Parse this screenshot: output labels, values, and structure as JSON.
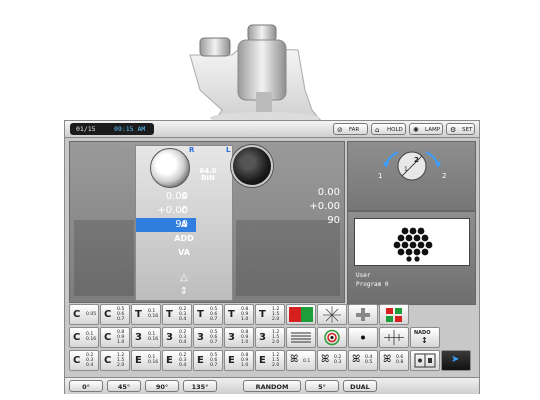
{
  "topbar": {
    "date": "01/15",
    "time": "09:15 AM",
    "buttons": [
      {
        "label": "FAR",
        "icon": "lens-icon"
      },
      {
        "label": "HOLD",
        "icon": "lock-icon"
      },
      {
        "label": "LAMP",
        "icon": "lamp-icon"
      },
      {
        "label": "SET",
        "icon": "gear-icon"
      }
    ]
  },
  "refraction": {
    "right_eye_label": "R",
    "left_eye_label": "L",
    "pd_value": "64.0",
    "pd_mode": "BIN",
    "rows": [
      {
        "label": "S",
        "right": "0.00",
        "left": "0.00"
      },
      {
        "label": "C",
        "right": "+0.00",
        "left": "+0.00"
      },
      {
        "label": "A",
        "right": "90",
        "left": "90"
      },
      {
        "label": "ADD",
        "right": "",
        "left": ""
      },
      {
        "label": "VA",
        "right": "",
        "left": ""
      }
    ]
  },
  "rotation": {
    "left_num": "1",
    "center_num": "2",
    "right_num": "2",
    "dial_num": "1"
  },
  "program": {
    "user_label": "User",
    "program_label": "Program 0"
  },
  "chart_grid": [
    [
      {
        "big": "C",
        "small": [
          "0.05"
        ]
      },
      {
        "big": "C",
        "small": [
          "0.5",
          "0.6",
          "0.7"
        ]
      },
      {
        "big": "T",
        "small": [
          "0.1",
          "0.16"
        ]
      },
      {
        "big": "T",
        "small": [
          "0.2",
          "0.3",
          "0.4"
        ]
      },
      {
        "big": "T",
        "small": [
          "0.5",
          "0.6",
          "0.7"
        ]
      },
      {
        "big": "T",
        "small": [
          "0.8",
          "0.9",
          "1.0"
        ]
      },
      {
        "big": "T",
        "small": [
          "1.2",
          "1.5",
          "2.0"
        ]
      }
    ],
    [
      {
        "big": "C",
        "small": [
          "0.1",
          "0.16"
        ]
      },
      {
        "big": "C",
        "small": [
          "0.8",
          "0.9",
          "1.0"
        ]
      },
      {
        "big": "3",
        "small": [
          "0.1",
          "0.16"
        ]
      },
      {
        "big": "3",
        "small": [
          "0.2",
          "0.3",
          "0.4"
        ]
      },
      {
        "big": "3",
        "small": [
          "0.5",
          "0.6",
          "0.7"
        ]
      },
      {
        "big": "3",
        "small": [
          "0.8",
          "0.9",
          "1.0"
        ]
      },
      {
        "big": "3",
        "small": [
          "1.2",
          "1.5",
          "2.0"
        ]
      }
    ],
    [
      {
        "big": "C",
        "small": [
          "0.2",
          "0.3",
          "0.4"
        ]
      },
      {
        "big": "C",
        "small": [
          "1.2",
          "1.5",
          "2.0"
        ]
      },
      {
        "big": "E",
        "small": [
          "0.1",
          "0.16"
        ]
      },
      {
        "big": "E",
        "small": [
          "0.2",
          "0.3",
          "0.4"
        ]
      },
      {
        "big": "E",
        "small": [
          "0.5",
          "0.6",
          "0.7"
        ]
      },
      {
        "big": "E",
        "small": [
          "0.8",
          "0.9",
          "1.0"
        ]
      },
      {
        "big": "E",
        "small": [
          "1.2",
          "1.5",
          "2.0"
        ]
      }
    ]
  ],
  "special_row3": [
    {
      "small": [
        "0.1"
      ]
    },
    {
      "small": [
        "0.2",
        "0.3"
      ]
    },
    {
      "small": [
        "0.4",
        "0.5"
      ]
    },
    {
      "small": [
        "0.6",
        "0.8"
      ]
    }
  ],
  "nado_label": "NADO",
  "bottombar": {
    "buttons": [
      "0°",
      "45°",
      "90°",
      "135°",
      "RANDOM",
      "5°",
      "DUAL"
    ]
  },
  "colors": {
    "accent": "#2f7ee0",
    "time": "#5fc7ff"
  }
}
